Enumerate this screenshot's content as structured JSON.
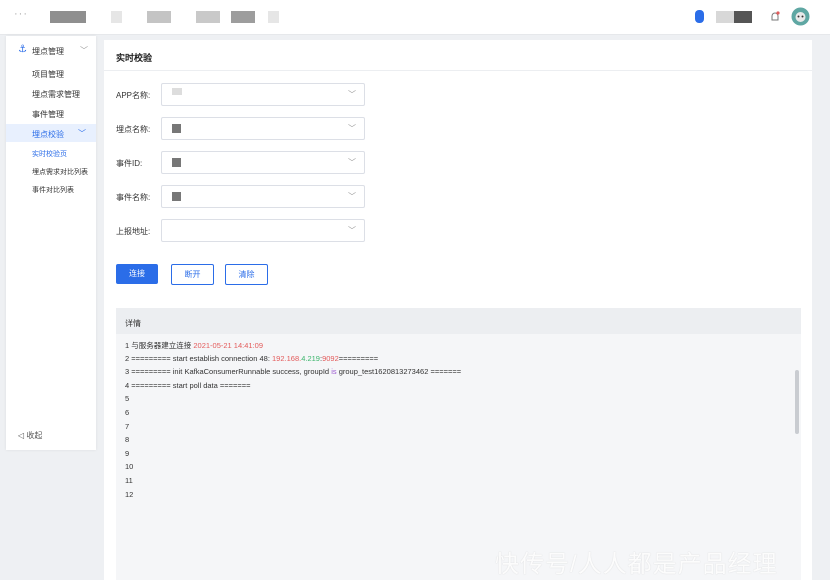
{
  "topbar": {
    "dots": "···",
    "colors": {
      "dark_block": "#9a9a9a",
      "light_block": "#e2e2e2",
      "accent": "#2b6de8"
    },
    "icons": [
      "notification-icon",
      "user-avatar"
    ]
  },
  "sidebar": {
    "group_label": "埋点管理",
    "items": [
      {
        "label": "项目管理"
      },
      {
        "label": "埋点需求管理"
      },
      {
        "label": "事件管理"
      },
      {
        "label": "埋点校验"
      }
    ],
    "sub_items": [
      {
        "label": "实时校验页"
      },
      {
        "label": "埋点需求对比列表"
      },
      {
        "label": "事件对比列表"
      }
    ],
    "collapse_label": "收起"
  },
  "main": {
    "title": "实时校验",
    "fields": [
      {
        "label": "APP名称:"
      },
      {
        "label": "埋点名称:"
      },
      {
        "label": "事件ID:"
      },
      {
        "label": "事件名称:"
      },
      {
        "label": "上报地址:"
      }
    ],
    "buttons": {
      "connect": "连接",
      "disconnect": "断开",
      "clear": "清除"
    },
    "detail_title": "详情",
    "log": {
      "l1_num": "1",
      "l1_text": "与服务器建立连接",
      "l1_time": "2021-05-21 14:41:09",
      "l2_num": "2",
      "l2_pre": "========= start establish connection 48: ",
      "l2_ip_a": "192.168.",
      "l2_ip_b": "4.219",
      "l2_sep": ":",
      "l2_port": "9092",
      "l2_post": "=========",
      "l3_num": "3",
      "l3_pre": "========= init KafkaConsumerRunnable success, groupId ",
      "l3_is": "is",
      "l3_post": " group_test1620813273462 =======",
      "l4_num": "4",
      "l4_text": "========= start poll data =======",
      "empty_lines": [
        "5",
        "6",
        "7",
        "8",
        "9",
        "10",
        "11",
        "12"
      ]
    },
    "watermark": "快传号/人人都是产品经理"
  }
}
